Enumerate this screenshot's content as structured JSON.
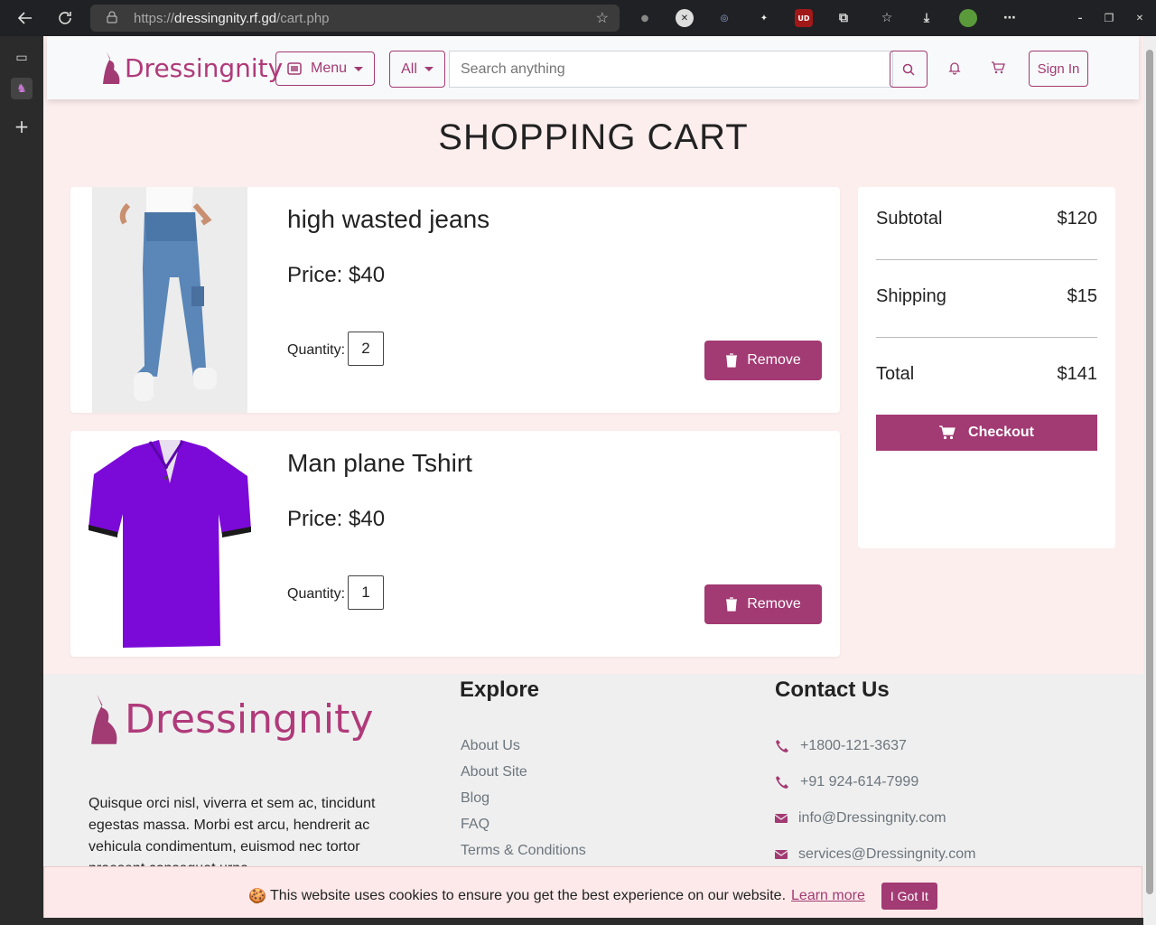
{
  "browser": {
    "url_scheme": "https://",
    "url_host": "dressingnity.rf.gd",
    "url_path": "/cart.php",
    "ext_ud": "UD"
  },
  "header": {
    "logo_text": "Dressingnity",
    "menu_label": "Menu",
    "category_label": "All",
    "search_placeholder": "Search anything",
    "signin_label": "Sign In"
  },
  "page": {
    "title": "SHOPPING CART"
  },
  "cart": {
    "items": [
      {
        "name": "high wasted jeans",
        "price": "Price: $40",
        "qty_label": "Quantity:",
        "qty": "2",
        "remove_label": "Remove"
      },
      {
        "name": "Man plane Tshirt",
        "price": "Price: $40",
        "qty_label": "Quantity:",
        "qty": "1",
        "remove_label": "Remove"
      }
    ]
  },
  "summary": {
    "subtotal_label": "Subtotal",
    "subtotal_value": "$120",
    "shipping_label": "Shipping",
    "shipping_value": "$15",
    "total_label": "Total",
    "total_value": "$141",
    "checkout_label": "Checkout"
  },
  "footer": {
    "logo_text": "Dressingnity",
    "description": "Quisque orci nisl, viverra et sem ac, tincidunt egestas massa. Morbi est arcu, hendrerit ac vehicula condimentum, euismod nec tortor praesent consequat urna.",
    "explore_heading": "Explore",
    "explore_links": [
      "About Us",
      "About Site",
      "Blog",
      "FAQ",
      "Terms & Conditions"
    ],
    "contact_heading": "Contact Us",
    "contacts": [
      {
        "icon": "phone-icon",
        "text": "+1800-121-3637"
      },
      {
        "icon": "phone-icon",
        "text": "+91 924-614-7999"
      },
      {
        "icon": "mail-icon",
        "text": "info@Dressingnity.com"
      },
      {
        "icon": "mail-icon",
        "text": "services@Dressingnity.com"
      }
    ]
  },
  "cookie": {
    "emoji": "🍪",
    "message": "This website uses cookies to ensure you get the best experience on our website.",
    "learn_more": "Learn more",
    "accept": "I Got It"
  },
  "colors": {
    "accent": "#a23a73",
    "page_bg": "#fdeeee",
    "footer_bg": "#efefef"
  }
}
